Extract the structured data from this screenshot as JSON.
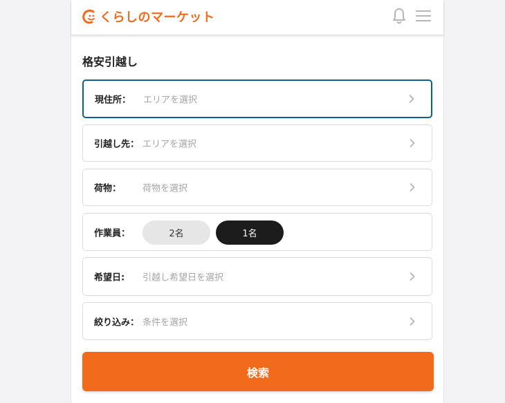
{
  "header": {
    "logo_text": "くらしのマーケット",
    "brand_color": "#f26a1b",
    "icons": [
      "bell-icon",
      "hamburger-menu-icon"
    ]
  },
  "page_title": "格安引越し",
  "form": {
    "current_address": {
      "label": "現住所：",
      "value": "エリアを選択"
    },
    "destination": {
      "label": "引越し先：",
      "value": "エリアを選択"
    },
    "baggage": {
      "label": "荷物：",
      "value": "荷物を選択"
    },
    "workers": {
      "label": "作業員：",
      "options": [
        "2名",
        "1名"
      ],
      "selected": "1名"
    },
    "desired_date": {
      "label": "希望日:",
      "value": "引越し希望日を選択"
    },
    "filter": {
      "label": "絞り込み：",
      "value": "条件を選択"
    }
  },
  "search_button": {
    "label": "検索"
  },
  "colors": {
    "accent": "#f26a1b",
    "active_border": "#0e5f8a",
    "selected_toggle": "#1c1c1c"
  }
}
